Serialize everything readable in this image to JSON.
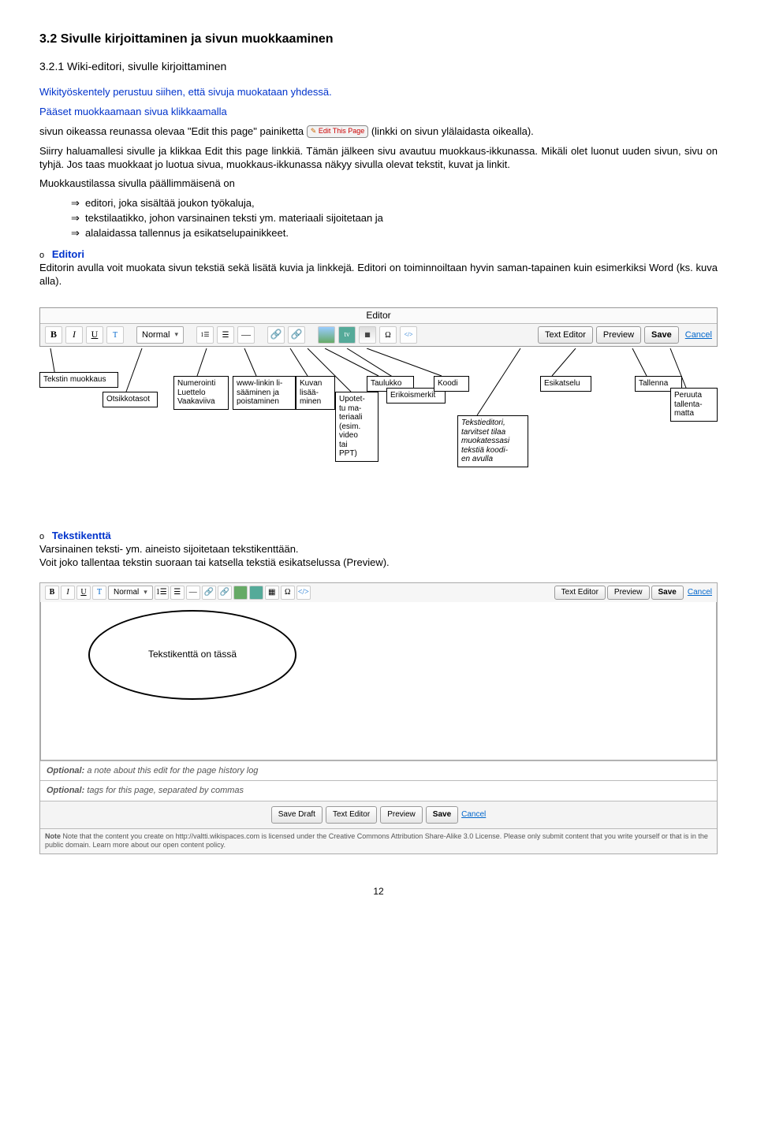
{
  "headings": {
    "h2": "3.2 Sivulle kirjoittaminen ja sivun muokkaaminen",
    "h3": "3.2.1 Wiki-editori, sivulle kirjoittaminen"
  },
  "intro": {
    "p1": "Wikityöskentely perustuu siihen, että sivuja muokataan yhdessä.",
    "p2a": "Pääset muokkaamaan sivua klikkaamalla",
    "p2b": "sivun oikeassa reunassa olevaa \"Edit this page\" painiketta ",
    "editBtn": "Edit This Page",
    "p2c": " (linkki on sivun ylälaidasta oikealla).",
    "p3": "Siirry haluamallesi sivulle ja klikkaa Edit this page linkkiä. Tämän jälkeen sivu avautuu muokkaus-ikkunassa. Mikäli olet luonut uuden sivun, sivu on tyhjä. Jos taas muokkaat jo luotua sivua, muokkaus-ikkunassa näkyy sivulla olevat tekstit, kuvat ja linkit.",
    "p4": "Muokkaustilassa sivulla päällimmäisenä on",
    "list": {
      "i1": "editori, joka sisältää joukon työkaluja,",
      "i2": "tekstilaatikko, johon varsinainen teksti ym. materiaali sijoitetaan ja",
      "i3": "alalaidassa tallennus ja esikatselupainikkeet."
    }
  },
  "editori": {
    "title": "Editori",
    "text": "Editorin avulla voit muokata sivun tekstiä sekä lisätä kuvia ja linkkejä. Editori on toiminnoiltaan hyvin saman-tapainen kuin esimerkiksi Word (ks. kuva alla)."
  },
  "toolbar": {
    "title": "Editor",
    "normal": "Normal",
    "textEditor": "Text Editor",
    "preview": "Preview",
    "save": "Save",
    "cancel": "Cancel"
  },
  "labels": {
    "tekstin": "Tekstin muokkaus",
    "otsikko": "Otsikkotasot",
    "numerointi": "Numerointi\nLuettelo\nVaakaviiva",
    "wwwlink": "www-linkin li-\nsääminen ja\npoistaminen",
    "kuvan": "Kuvan\nlisää-\nminen",
    "upotettu": "Upotet-\ntu ma-\nteriaali\n(esim.\nvideo\ntai\nPPT)",
    "taulukko": "Taulukko",
    "erikois": "Erikoismerkit",
    "koodi": "Koodi",
    "tekstieditori": "Tekstieditori,\ntarvitset tilaa\nmuokatessasi\ntekstiä koodi-\nen avulla",
    "esikatselu": "Esikatselu",
    "tallenna": "Tallenna",
    "peruuta": "Peruuta\ntallenta-\nmatta"
  },
  "tekstikentta": {
    "title": "Tekstikenttä",
    "p1": "Varsinainen teksti- ym. aineisto sijoitetaan tekstikenttään.",
    "p2": "Voit joko tallentaa tekstin suoraan tai katsella tekstiä esikatselussa (Preview).",
    "oval": "Tekstikenttä on tässä",
    "opt1a": "Optional:",
    "opt1b": " a note about this edit for the page history log",
    "opt2a": "Optional:",
    "opt2b": " tags for this page, separated by commas",
    "saveDraft": "Save Draft",
    "noteText": "Note that the content you create on http://valtti.wikispaces.com is licensed under the Creative Commons Attribution Share-Alike 3.0 License. Please only submit content that you write yourself or that is in the public domain. Learn more about our open content policy."
  },
  "pagenum": "12"
}
